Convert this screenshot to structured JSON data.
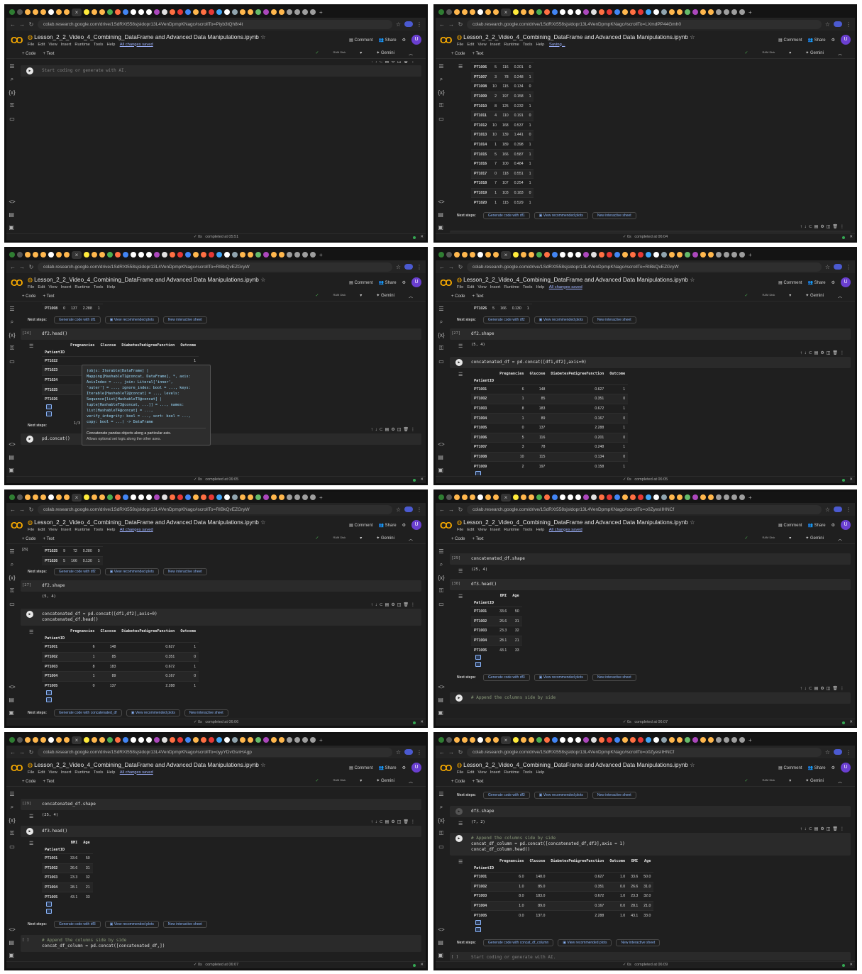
{
  "common": {
    "notebook_title": "Lesson_2_2_Video_4_Combining_DataFrame and Advanced Data Manipulations.ipynb",
    "menu": [
      "File",
      "Edit",
      "View",
      "Insert",
      "Runtime",
      "Tools",
      "Help"
    ],
    "comment": "Comment",
    "share": "Share",
    "avatar": "U",
    "add_code": "+ Code",
    "add_text": "+ Text",
    "ram_disk": "RAM Disk",
    "gemini": "✦ Gemini",
    "next_steps": "Next steps:",
    "view_plots": "View recommended plots",
    "new_sheet": "New interactive sheet",
    "placeholder": "Start coding or generate with AI.",
    "exec_time": "0s"
  },
  "panels": [
    {
      "url": "colab.research.google.com/drive/1SdRXt558sjsldopr13L4VenDpmpKNagc#scrollTo=Piyb3tQh8r4t",
      "save_status": "All changes saved",
      "status": "completed at 05:51"
    },
    {
      "url": "colab.research.google.com/drive/1SdRXt558sjsldopr13L4VenDpmpKNagc#scrollTo=LXmdPP44Gmh0",
      "save_status": "Saving...",
      "status": "completed at 06:04",
      "rows": [
        [
          "PT1006",
          "5",
          "116",
          "0.201",
          "0"
        ],
        [
          "PT1007",
          "3",
          "78",
          "0.248",
          "1"
        ],
        [
          "PT1008",
          "10",
          "115",
          "0.134",
          "0"
        ],
        [
          "PT1009",
          "2",
          "197",
          "0.158",
          "1"
        ],
        [
          "PT1010",
          "8",
          "125",
          "0.232",
          "1"
        ],
        [
          "PT1011",
          "4",
          "110",
          "0.191",
          "0"
        ],
        [
          "PT1012",
          "10",
          "168",
          "0.537",
          "1"
        ],
        [
          "PT1013",
          "10",
          "139",
          "1.441",
          "0"
        ],
        [
          "PT1014",
          "1",
          "189",
          "0.398",
          "1"
        ],
        [
          "PT1015",
          "5",
          "166",
          "0.587",
          "1"
        ],
        [
          "PT1016",
          "7",
          "100",
          "0.484",
          "1"
        ],
        [
          "PT1017",
          "0",
          "118",
          "0.551",
          "1"
        ],
        [
          "PT1018",
          "7",
          "107",
          "0.254",
          "1"
        ],
        [
          "PT1019",
          "1",
          "103",
          "0.183",
          "0"
        ],
        [
          "PT1020",
          "1",
          "115",
          "0.529",
          "1"
        ]
      ],
      "gen": "Generate code with df1"
    },
    {
      "url": "colab.research.google.com/drive/1SdRXt558sjsldopr13L4VenDpmpKNagc#scrollTo=RIBkQvEZGryW",
      "save_status": "",
      "status": "completed at 06:05",
      "top_row": [
        "PT1008",
        "0",
        "137",
        "2.288",
        "1"
      ],
      "gen1": "Generate code with df1",
      "cell_label": "[24]",
      "cell_code": "df2.head()",
      "headers": [
        "Pregnancies",
        "Glucose",
        "DiabetesPedigreeFunction",
        "Outcome"
      ],
      "index_name": "PatientID",
      "rows": [
        [
          "PT1022",
          "",
          "",
          "",
          "1"
        ],
        [
          "PT1023",
          "",
          "",
          "",
          "0"
        ],
        [
          "PT1024",
          "",
          "",
          "",
          "1"
        ],
        [
          "PT1025",
          "",
          "",
          "",
          "1"
        ],
        [
          "PT1026",
          "",
          "",
          "",
          "1"
        ]
      ],
      "tooltip_sig": "(objs: Iterable[DataFrame] |\nMapping[HashableT1@concat, DataFrame], *, axis:\nAxisIndex = ..., join: Literal['inner',\n'outer'] = ..., ignore_index: bool = ..., keys:\nIterable[HashableT2@concat] = ..., levels:\nSequence[list[HashableT3@concat] |\ntuple[HashableT3@concat, ...]] = ..., names:\nlist[HashableT4@concat] = ...,\nverify_integrity: bool = ..., sort: bool = ...,\ncopy: bool = ...) -> DataFrame",
      "tooltip_doc": "Concatenate pandas objects along a particular axis.",
      "tooltip_doc2": "Allows optional set logic along the other axes.",
      "tooltip_page": "1/3",
      "typing": "pd.concat()"
    },
    {
      "url": "colab.research.google.com/drive/1SdRXt558sjsldopr13L4VenDpmpKNagc#scrollTo=RIBkQvEZGryW",
      "save_status": "All changes saved",
      "status": "completed at 06:05",
      "top_row": [
        "PT1026",
        "5",
        "166",
        "0.130",
        "1"
      ],
      "gen": "Generate code with df2",
      "cell1_label": "[27]",
      "cell1_code": "df2.shape",
      "cell1_out": "(5, 4)",
      "cell2_code": "concatenated_df = pd.concat([df1,df2],axis=0)",
      "headers": [
        "Pregnancies",
        "Glucose",
        "DiabetesPedigreeFunction",
        "Outcome"
      ],
      "index_name": "PatientID",
      "rows": [
        [
          "PT1001",
          "6",
          "148",
          "0.627",
          "1"
        ],
        [
          "PT1002",
          "1",
          "85",
          "0.351",
          "0"
        ],
        [
          "PT1003",
          "8",
          "183",
          "0.672",
          "1"
        ],
        [
          "PT1004",
          "1",
          "89",
          "0.167",
          "0"
        ],
        [
          "PT1005",
          "0",
          "137",
          "2.288",
          "1"
        ],
        [
          "PT1006",
          "5",
          "116",
          "0.201",
          "0"
        ],
        [
          "PT1007",
          "3",
          "78",
          "0.248",
          "1"
        ],
        [
          "PT1008",
          "10",
          "115",
          "0.134",
          "0"
        ],
        [
          "PT1009",
          "2",
          "197",
          "0.158",
          "1"
        ]
      ]
    },
    {
      "url": "colab.research.google.com/drive/1SdRXt558sjsldopr13L4VenDpmpKNagc#scrollTo=RIBkQvEZGryW",
      "save_status": "All changes saved",
      "status": "completed at 06:06",
      "top_rows": [
        [
          "PT1025",
          "9",
          "72",
          "0.280",
          "0"
        ],
        [
          "PT1026",
          "5",
          "166",
          "0.130",
          "1"
        ]
      ],
      "top_label": "[26]",
      "gen": "Generate code with df2",
      "cell1_label": "[27]",
      "cell1_code": "df2.shape",
      "cell1_out": "(5, 4)",
      "cell2_code": "concatenated_df = pd.concat([df1,df2],axis=0)",
      "cell2_code2": "concatenated_df.head()",
      "headers": [
        "Pregnancies",
        "Glucose",
        "DiabetesPedigreeFunction",
        "Outcome"
      ],
      "index_name": "PatientID",
      "rows": [
        [
          "PT1001",
          "6",
          "148",
          "0.627",
          "1"
        ],
        [
          "PT1002",
          "1",
          "85",
          "0.351",
          "0"
        ],
        [
          "PT1003",
          "8",
          "183",
          "0.672",
          "1"
        ],
        [
          "PT1004",
          "1",
          "89",
          "0.167",
          "0"
        ],
        [
          "PT1005",
          "0",
          "137",
          "2.288",
          "1"
        ]
      ],
      "gen2": "Generate code with concatenated_df"
    },
    {
      "url": "colab.research.google.com/drive/1SdRXt558sjsldopr13L4VenDpmpKNagc#scrollTo=o0ZyesIIHNCf",
      "save_status": "All changes saved",
      "status": "completed at 06:07",
      "cell1_label": "[29]",
      "cell1_code": "concatenated_df.shape",
      "cell1_out": "(25, 4)",
      "cell2_label": "[30]",
      "cell2_code": "df3.head()",
      "headers": [
        "BMI",
        "Age"
      ],
      "index_name": "PatientID",
      "rows": [
        [
          "PT1001",
          "33.6",
          "50"
        ],
        [
          "PT1002",
          "26.6",
          "31"
        ],
        [
          "PT1003",
          "23.3",
          "32"
        ],
        [
          "PT1004",
          "28.1",
          "21"
        ],
        [
          "PT1005",
          "43.1",
          "33"
        ]
      ],
      "gen": "Generate code with df3",
      "cell3_code": "# Append the columns side by side"
    },
    {
      "url": "colab.research.google.com/drive/1SdRXt558sjsldopr13L4VenDpmpKNagc#scrollTo=oyyYDvGsnHAgp",
      "save_status": "All changes saved",
      "status": "completed at 06:07",
      "cell1_label": "[29]",
      "cell1_code": "concatenated_df.shape",
      "cell1_out": "(25, 4)",
      "cell2_code": "df3.head()",
      "headers": [
        "BMI",
        "Age"
      ],
      "index_name": "PatientID",
      "rows": [
        [
          "PT1001",
          "33.6",
          "50"
        ],
        [
          "PT1002",
          "26.6",
          "31"
        ],
        [
          "PT1003",
          "23.3",
          "32"
        ],
        [
          "PT1004",
          "28.1",
          "21"
        ],
        [
          "PT1005",
          "43.1",
          "33"
        ]
      ],
      "gen": "Generate code with df3",
      "cell3_label": "[ ]",
      "cell3_line1": "# Append the columns side by side",
      "cell3_line2": "concat_df_column = pd.concat([concatenated_df,])"
    },
    {
      "url": "colab.research.google.com/drive/1SdRXt558sjsldopr13L4VenDpmpKNagc#scrollTo=o0ZyesIIHNCf",
      "save_status": "",
      "status": "completed at 06:09",
      "gen_top": "Generate code with df3",
      "cell1_code": "df3.shape",
      "cell1_out": "(7, 2)",
      "cell2_line1": "# Append the columns side by side",
      "cell2_line2": "concat_df_column = pd.concat([concatenated_df,df3],axis = 1)",
      "cell2_line3": "concat_df_column.head()",
      "headers": [
        "Pregnancies",
        "Glucose",
        "DiabetesPedigreeFunction",
        "Outcome",
        "BMI",
        "Age"
      ],
      "index_name": "PatientID",
      "rows": [
        [
          "PT1001",
          "6.0",
          "148.0",
          "0.627",
          "1.0",
          "33.6",
          "50.0"
        ],
        [
          "PT1002",
          "1.0",
          "85.0",
          "0.351",
          "0.0",
          "26.6",
          "31.0"
        ],
        [
          "PT1003",
          "8.0",
          "183.0",
          "0.672",
          "1.0",
          "23.3",
          "32.0"
        ],
        [
          "PT1004",
          "1.0",
          "89.0",
          "0.167",
          "0.0",
          "28.1",
          "21.0"
        ],
        [
          "PT1005",
          "0.0",
          "137.0",
          "2.288",
          "1.0",
          "43.1",
          "33.0"
        ]
      ],
      "gen": "Generate code with concat_df_column",
      "cell3_label": "[ ]"
    }
  ],
  "colors": {
    "bg": "#1f1f1f",
    "cell": "#2a2a2a",
    "link": "#8ab4f8",
    "accent": "#f9ab00",
    "ok": "#34a853"
  }
}
